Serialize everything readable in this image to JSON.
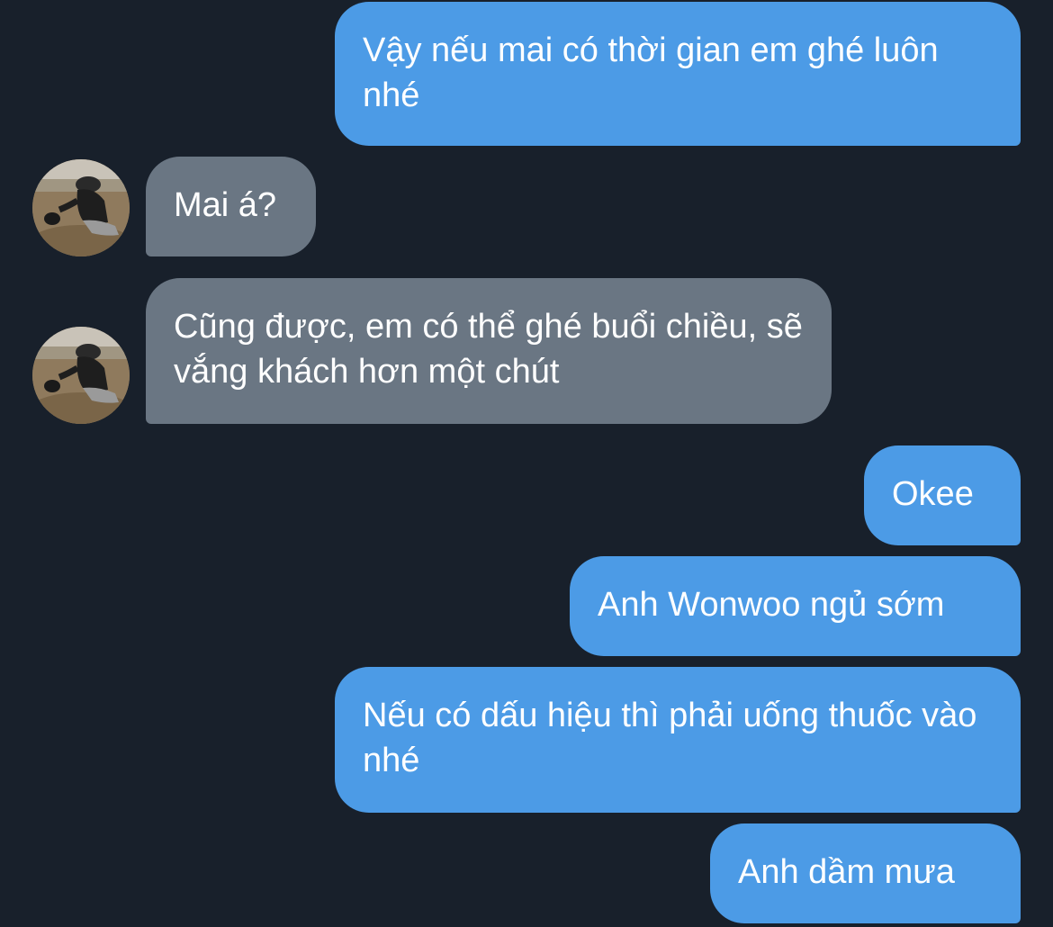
{
  "conversation": {
    "messages": [
      {
        "side": "out",
        "text": "Vậy nếu mai có thời gian em ghé luôn nhé"
      },
      {
        "side": "in",
        "text": "Mai á?"
      },
      {
        "side": "in",
        "text": "Cũng được, em có thể ghé buổi chiều, sẽ vắng khách hơn một chút"
      },
      {
        "side": "out",
        "text": "Okee"
      },
      {
        "side": "out",
        "text": "Anh Wonwoo ngủ sớm"
      },
      {
        "side": "out",
        "text": "Nếu có dấu hiệu thì phải uống thuốc vào nhé"
      },
      {
        "side": "out",
        "text": "Anh dầm mưa"
      }
    ]
  },
  "colors": {
    "background": "#18202b",
    "outgoing_bubble": "#4c9be6",
    "incoming_bubble": "#6a7683",
    "text": "#ffffff"
  },
  "icons": {
    "contact_avatar": "person-crouching-photo"
  }
}
